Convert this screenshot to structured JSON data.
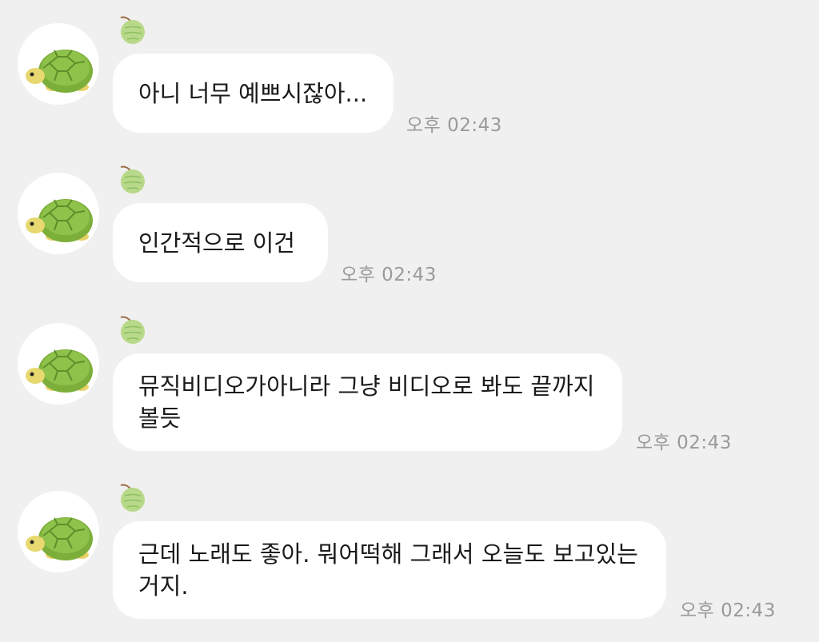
{
  "messages": [
    {
      "text": "아니 너무 예쁘시잖아...",
      "time": "오후 02:43"
    },
    {
      "text": "인간적으로 이건",
      "time": "오후 02:43"
    },
    {
      "text": "뮤직비디오가아니라 그냥 비디오로 봐도 끝까지\n볼듯",
      "time": "오후 02:43"
    },
    {
      "text": "근데 노래도 좋아. 뭐어떡해 그래서 오늘도 보고있는\n거지.",
      "time": "오후 02:43"
    }
  ],
  "icons": {
    "avatar": "turtle-avatar-icon",
    "sender_badge": "melon-icon"
  },
  "colors": {
    "background": "#f0f0f0",
    "bubble": "#ffffff",
    "text": "#1a1a1a",
    "timestamp": "#9a9a9a"
  }
}
